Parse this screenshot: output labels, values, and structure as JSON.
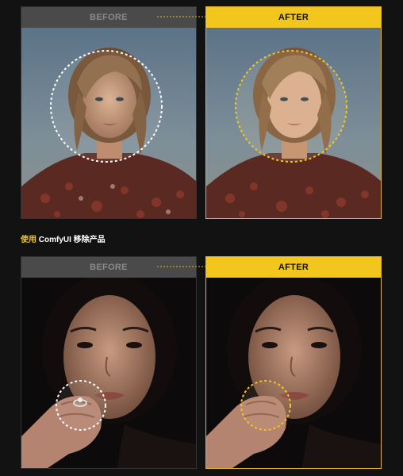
{
  "colors": {
    "accent": "#f3c61d",
    "before_header_bg": "#4a4a4a",
    "page_bg": "#121212"
  },
  "comparison_1": {
    "before_label": "BEFORE",
    "after_label": "AFTER"
  },
  "caption": {
    "highlight": "使用",
    "text": " ComfyUI 移除产品"
  },
  "comparison_2": {
    "before_label": "BEFORE",
    "after_label": "AFTER"
  },
  "icons": {
    "connector": "dotted-arrow-icon",
    "focus_circle": "dashed-circle-icon"
  }
}
